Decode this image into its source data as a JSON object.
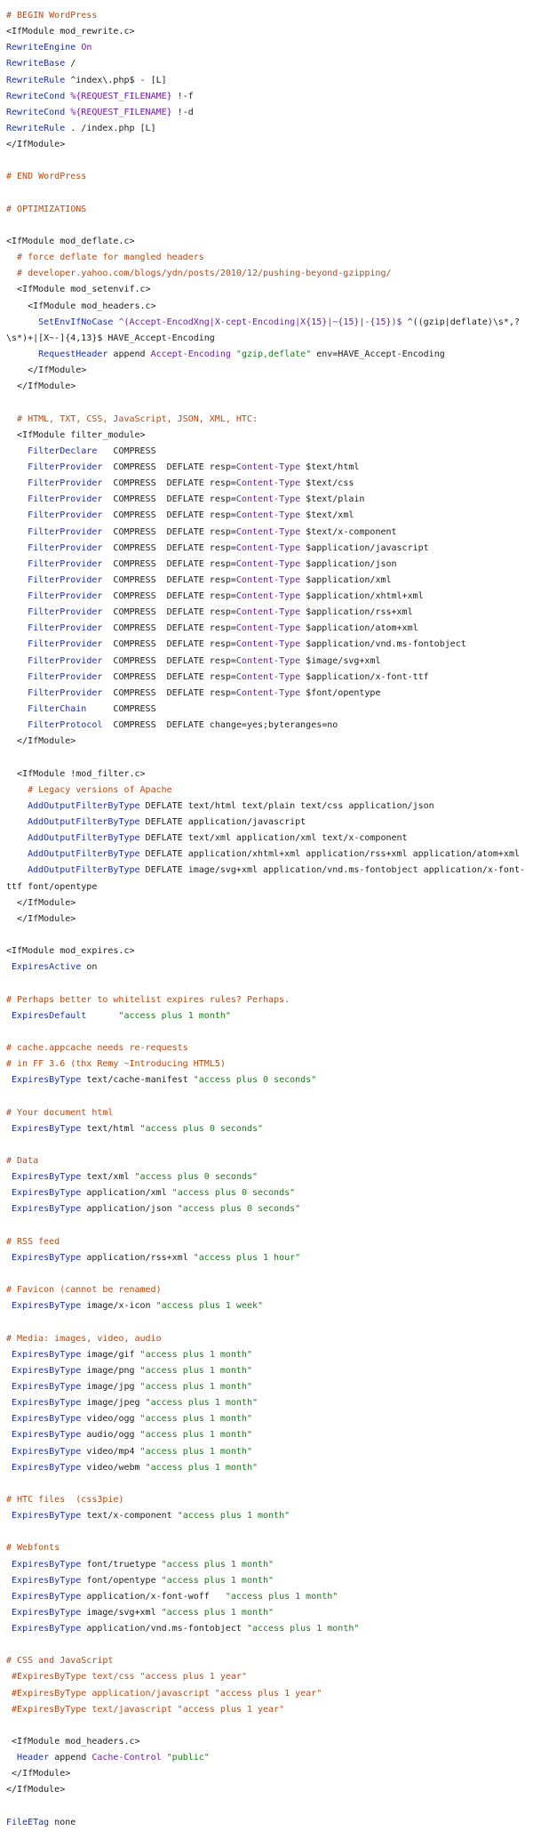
{
  "file": {
    "lines": [
      [
        [
          "c",
          "# BEGIN WordPress"
        ]
      ],
      [
        [
          "t",
          "<IfModule mod_rewrite.c>"
        ]
      ],
      [
        [
          "d",
          "RewriteEngine"
        ],
        [
          "p",
          " "
        ],
        [
          "v",
          "On"
        ]
      ],
      [
        [
          "d",
          "RewriteBase"
        ],
        [
          "p",
          " /"
        ]
      ],
      [
        [
          "d",
          "RewriteRule"
        ],
        [
          "p",
          " ^index\\.php$ - [L]"
        ]
      ],
      [
        [
          "d",
          "RewriteCond"
        ],
        [
          "p",
          " "
        ],
        [
          "v",
          "%{REQUEST_FILENAME}"
        ],
        [
          "p",
          " !-f"
        ]
      ],
      [
        [
          "d",
          "RewriteCond"
        ],
        [
          "p",
          " "
        ],
        [
          "v",
          "%{REQUEST_FILENAME}"
        ],
        [
          "p",
          " !-d"
        ]
      ],
      [
        [
          "d",
          "RewriteRule"
        ],
        [
          "p",
          " . /index.php [L]"
        ]
      ],
      [
        [
          "t",
          "</IfModule>"
        ]
      ],
      [],
      [
        [
          "c",
          "# END WordPress"
        ]
      ],
      [],
      [
        [
          "c",
          "# OPTIMIZATIONS"
        ]
      ],
      [],
      [
        [
          "t",
          "<IfModule mod_deflate.c>"
        ]
      ],
      [
        [
          "p",
          "  "
        ],
        [
          "c",
          "# force deflate for mangled headers"
        ]
      ],
      [
        [
          "p",
          "  "
        ],
        [
          "c",
          "# developer.yahoo.com/blogs/ydn/posts/2010/12/pushing-beyond-gzipping/"
        ]
      ],
      [
        [
          "p",
          "  "
        ],
        [
          "t",
          "<IfModule mod_setenvif.c>"
        ]
      ],
      [
        [
          "p",
          "    "
        ],
        [
          "t",
          "<IfModule mod_headers.c>"
        ]
      ],
      [
        [
          "p",
          "      "
        ],
        [
          "d",
          "SetEnvIfNoCase"
        ],
        [
          "p",
          " "
        ],
        [
          "v",
          "^(Accept-EncodXng|X-cept-Encoding|X{15}|~{15}|-{15})$"
        ],
        [
          "p",
          " ^((gzip|deflate)\\s*,?"
        ]
      ],
      [
        [
          "p",
          "\\s*)+|[X~-]{4,13}$ HAVE_Accept-Encoding"
        ]
      ],
      [
        [
          "p",
          "      "
        ],
        [
          "d",
          "RequestHeader"
        ],
        [
          "p",
          " append "
        ],
        [
          "v",
          "Accept-Encoding"
        ],
        [
          "p",
          " "
        ],
        [
          "s",
          "\"gzip,deflate\""
        ],
        [
          "p",
          " env=HAVE_Accept-Encoding"
        ]
      ],
      [
        [
          "p",
          "    "
        ],
        [
          "t",
          "</IfModule>"
        ]
      ],
      [
        [
          "p",
          "  "
        ],
        [
          "t",
          "</IfModule>"
        ]
      ],
      [],
      [
        [
          "p",
          "  "
        ],
        [
          "c",
          "# HTML, TXT, CSS, JavaScript, JSON, XML, HTC:"
        ]
      ],
      [
        [
          "p",
          "  "
        ],
        [
          "t",
          "<IfModule filter_module>"
        ]
      ],
      [
        [
          "p",
          "    "
        ],
        [
          "d",
          "FilterDeclare"
        ],
        [
          "p",
          "   COMPRESS"
        ]
      ],
      [
        [
          "p",
          "    "
        ],
        [
          "d",
          "FilterProvider"
        ],
        [
          "p",
          "  COMPRESS  DEFLATE resp="
        ],
        [
          "v",
          "Content-Type"
        ],
        [
          "p",
          " $text/html"
        ]
      ],
      [
        [
          "p",
          "    "
        ],
        [
          "d",
          "FilterProvider"
        ],
        [
          "p",
          "  COMPRESS  DEFLATE resp="
        ],
        [
          "v",
          "Content-Type"
        ],
        [
          "p",
          " $text/css"
        ]
      ],
      [
        [
          "p",
          "    "
        ],
        [
          "d",
          "FilterProvider"
        ],
        [
          "p",
          "  COMPRESS  DEFLATE resp="
        ],
        [
          "v",
          "Content-Type"
        ],
        [
          "p",
          " $text/plain"
        ]
      ],
      [
        [
          "p",
          "    "
        ],
        [
          "d",
          "FilterProvider"
        ],
        [
          "p",
          "  COMPRESS  DEFLATE resp="
        ],
        [
          "v",
          "Content-Type"
        ],
        [
          "p",
          " $text/xml"
        ]
      ],
      [
        [
          "p",
          "    "
        ],
        [
          "d",
          "FilterProvider"
        ],
        [
          "p",
          "  COMPRESS  DEFLATE resp="
        ],
        [
          "v",
          "Content-Type"
        ],
        [
          "p",
          " $text/x-component"
        ]
      ],
      [
        [
          "p",
          "    "
        ],
        [
          "d",
          "FilterProvider"
        ],
        [
          "p",
          "  COMPRESS  DEFLATE resp="
        ],
        [
          "v",
          "Content-Type"
        ],
        [
          "p",
          " $application/javascript"
        ]
      ],
      [
        [
          "p",
          "    "
        ],
        [
          "d",
          "FilterProvider"
        ],
        [
          "p",
          "  COMPRESS  DEFLATE resp="
        ],
        [
          "v",
          "Content-Type"
        ],
        [
          "p",
          " $application/json"
        ]
      ],
      [
        [
          "p",
          "    "
        ],
        [
          "d",
          "FilterProvider"
        ],
        [
          "p",
          "  COMPRESS  DEFLATE resp="
        ],
        [
          "v",
          "Content-Type"
        ],
        [
          "p",
          " $application/xml"
        ]
      ],
      [
        [
          "p",
          "    "
        ],
        [
          "d",
          "FilterProvider"
        ],
        [
          "p",
          "  COMPRESS  DEFLATE resp="
        ],
        [
          "v",
          "Content-Type"
        ],
        [
          "p",
          " $application/xhtml+xml"
        ]
      ],
      [
        [
          "p",
          "    "
        ],
        [
          "d",
          "FilterProvider"
        ],
        [
          "p",
          "  COMPRESS  DEFLATE resp="
        ],
        [
          "v",
          "Content-Type"
        ],
        [
          "p",
          " $application/rss+xml"
        ]
      ],
      [
        [
          "p",
          "    "
        ],
        [
          "d",
          "FilterProvider"
        ],
        [
          "p",
          "  COMPRESS  DEFLATE resp="
        ],
        [
          "v",
          "Content-Type"
        ],
        [
          "p",
          " $application/atom+xml"
        ]
      ],
      [
        [
          "p",
          "    "
        ],
        [
          "d",
          "FilterProvider"
        ],
        [
          "p",
          "  COMPRESS  DEFLATE resp="
        ],
        [
          "v",
          "Content-Type"
        ],
        [
          "p",
          " $application/vnd.ms-fontobject"
        ]
      ],
      [
        [
          "p",
          "    "
        ],
        [
          "d",
          "FilterProvider"
        ],
        [
          "p",
          "  COMPRESS  DEFLATE resp="
        ],
        [
          "v",
          "Content-Type"
        ],
        [
          "p",
          " $image/svg+xml"
        ]
      ],
      [
        [
          "p",
          "    "
        ],
        [
          "d",
          "FilterProvider"
        ],
        [
          "p",
          "  COMPRESS  DEFLATE resp="
        ],
        [
          "v",
          "Content-Type"
        ],
        [
          "p",
          " $application/x-font-ttf"
        ]
      ],
      [
        [
          "p",
          "    "
        ],
        [
          "d",
          "FilterProvider"
        ],
        [
          "p",
          "  COMPRESS  DEFLATE resp="
        ],
        [
          "v",
          "Content-Type"
        ],
        [
          "p",
          " $font/opentype"
        ]
      ],
      [
        [
          "p",
          "    "
        ],
        [
          "d",
          "FilterChain"
        ],
        [
          "p",
          "     COMPRESS"
        ]
      ],
      [
        [
          "p",
          "    "
        ],
        [
          "d",
          "FilterProtocol"
        ],
        [
          "p",
          "  COMPRESS  DEFLATE change=yes;byteranges=no"
        ]
      ],
      [
        [
          "p",
          "  "
        ],
        [
          "t",
          "</IfModule>"
        ]
      ],
      [],
      [
        [
          "p",
          "  "
        ],
        [
          "t",
          "<IfModule !mod_filter.c>"
        ]
      ],
      [
        [
          "p",
          "    "
        ],
        [
          "c",
          "# Legacy versions of Apache"
        ]
      ],
      [
        [
          "p",
          "    "
        ],
        [
          "d",
          "AddOutputFilterByType"
        ],
        [
          "p",
          " DEFLATE text/html text/plain text/css application/json"
        ]
      ],
      [
        [
          "p",
          "    "
        ],
        [
          "d",
          "AddOutputFilterByType"
        ],
        [
          "p",
          " DEFLATE application/javascript"
        ]
      ],
      [
        [
          "p",
          "    "
        ],
        [
          "d",
          "AddOutputFilterByType"
        ],
        [
          "p",
          " DEFLATE text/xml application/xml text/x-component"
        ]
      ],
      [
        [
          "p",
          "    "
        ],
        [
          "d",
          "AddOutputFilterByType"
        ],
        [
          "p",
          " DEFLATE application/xhtml+xml application/rss+xml application/atom+xml"
        ]
      ],
      [
        [
          "p",
          "    "
        ],
        [
          "d",
          "AddOutputFilterByType"
        ],
        [
          "p",
          " DEFLATE image/svg+xml application/vnd.ms-fontobject application/x-font-"
        ]
      ],
      [
        [
          "p",
          "ttf font/opentype"
        ]
      ],
      [
        [
          "p",
          "  "
        ],
        [
          "t",
          "</IfModule>"
        ]
      ],
      [
        [
          "p",
          "  "
        ],
        [
          "t",
          "</IfModule>"
        ]
      ],
      [],
      [
        [
          "t",
          "<IfModule mod_expires.c>"
        ]
      ],
      [
        [
          "p",
          " "
        ],
        [
          "d",
          "ExpiresActive"
        ],
        [
          "p",
          " on"
        ]
      ],
      [],
      [
        [
          "c",
          "# Perhaps better to whitelist expires rules? Perhaps."
        ]
      ],
      [
        [
          "p",
          " "
        ],
        [
          "d",
          "ExpiresDefault"
        ],
        [
          "p",
          "      "
        ],
        [
          "s",
          "\"access plus 1 month\""
        ]
      ],
      [],
      [
        [
          "c",
          "# cache.appcache needs re-requests"
        ]
      ],
      [
        [
          "c",
          "# in FF 3.6 (thx Remy ~Introducing HTML5)"
        ]
      ],
      [
        [
          "p",
          " "
        ],
        [
          "d",
          "ExpiresByType"
        ],
        [
          "p",
          " text/cache-manifest "
        ],
        [
          "s",
          "\"access plus 0 seconds\""
        ]
      ],
      [],
      [
        [
          "c",
          "# Your document html"
        ]
      ],
      [
        [
          "p",
          " "
        ],
        [
          "d",
          "ExpiresByType"
        ],
        [
          "p",
          " text/html "
        ],
        [
          "s",
          "\"access plus 0 seconds\""
        ]
      ],
      [],
      [
        [
          "c",
          "# Data"
        ]
      ],
      [
        [
          "p",
          " "
        ],
        [
          "d",
          "ExpiresByType"
        ],
        [
          "p",
          " text/xml "
        ],
        [
          "s",
          "\"access plus 0 seconds\""
        ]
      ],
      [
        [
          "p",
          " "
        ],
        [
          "d",
          "ExpiresByType"
        ],
        [
          "p",
          " application/xml "
        ],
        [
          "s",
          "\"access plus 0 seconds\""
        ]
      ],
      [
        [
          "p",
          " "
        ],
        [
          "d",
          "ExpiresByType"
        ],
        [
          "p",
          " application/json "
        ],
        [
          "s",
          "\"access plus 0 seconds\""
        ]
      ],
      [],
      [
        [
          "c",
          "# RSS feed"
        ]
      ],
      [
        [
          "p",
          " "
        ],
        [
          "d",
          "ExpiresByType"
        ],
        [
          "p",
          " application/rss+xml "
        ],
        [
          "s",
          "\"access plus 1 hour\""
        ]
      ],
      [],
      [
        [
          "c",
          "# Favicon (cannot be renamed)"
        ]
      ],
      [
        [
          "p",
          " "
        ],
        [
          "d",
          "ExpiresByType"
        ],
        [
          "p",
          " image/x-icon "
        ],
        [
          "s",
          "\"access plus 1 week\""
        ]
      ],
      [],
      [
        [
          "c",
          "# Media: images, video, audio"
        ]
      ],
      [
        [
          "p",
          " "
        ],
        [
          "d",
          "ExpiresByType"
        ],
        [
          "p",
          " image/gif "
        ],
        [
          "s",
          "\"access plus 1 month\""
        ]
      ],
      [
        [
          "p",
          " "
        ],
        [
          "d",
          "ExpiresByType"
        ],
        [
          "p",
          " image/png "
        ],
        [
          "s",
          "\"access plus 1 month\""
        ]
      ],
      [
        [
          "p",
          " "
        ],
        [
          "d",
          "ExpiresByType"
        ],
        [
          "p",
          " image/jpg "
        ],
        [
          "s",
          "\"access plus 1 month\""
        ]
      ],
      [
        [
          "p",
          " "
        ],
        [
          "d",
          "ExpiresByType"
        ],
        [
          "p",
          " image/jpeg "
        ],
        [
          "s",
          "\"access plus 1 month\""
        ]
      ],
      [
        [
          "p",
          " "
        ],
        [
          "d",
          "ExpiresByType"
        ],
        [
          "p",
          " video/ogg "
        ],
        [
          "s",
          "\"access plus 1 month\""
        ]
      ],
      [
        [
          "p",
          " "
        ],
        [
          "d",
          "ExpiresByType"
        ],
        [
          "p",
          " audio/ogg "
        ],
        [
          "s",
          "\"access plus 1 month\""
        ]
      ],
      [
        [
          "p",
          " "
        ],
        [
          "d",
          "ExpiresByType"
        ],
        [
          "p",
          " video/mp4 "
        ],
        [
          "s",
          "\"access plus 1 month\""
        ]
      ],
      [
        [
          "p",
          " "
        ],
        [
          "d",
          "ExpiresByType"
        ],
        [
          "p",
          " video/webm "
        ],
        [
          "s",
          "\"access plus 1 month\""
        ]
      ],
      [],
      [
        [
          "c",
          "# HTC files  (css3pie)"
        ]
      ],
      [
        [
          "p",
          " "
        ],
        [
          "d",
          "ExpiresByType"
        ],
        [
          "p",
          " text/x-component "
        ],
        [
          "s",
          "\"access plus 1 month\""
        ]
      ],
      [],
      [
        [
          "c",
          "# Webfonts"
        ]
      ],
      [
        [
          "p",
          " "
        ],
        [
          "d",
          "ExpiresByType"
        ],
        [
          "p",
          " font/truetype "
        ],
        [
          "s",
          "\"access plus 1 month\""
        ]
      ],
      [
        [
          "p",
          " "
        ],
        [
          "d",
          "ExpiresByType"
        ],
        [
          "p",
          " font/opentype "
        ],
        [
          "s",
          "\"access plus 1 month\""
        ]
      ],
      [
        [
          "p",
          " "
        ],
        [
          "d",
          "ExpiresByType"
        ],
        [
          "p",
          " application/x-font-woff   "
        ],
        [
          "s",
          "\"access plus 1 month\""
        ]
      ],
      [
        [
          "p",
          " "
        ],
        [
          "d",
          "ExpiresByType"
        ],
        [
          "p",
          " image/svg+xml "
        ],
        [
          "s",
          "\"access plus 1 month\""
        ]
      ],
      [
        [
          "p",
          " "
        ],
        [
          "d",
          "ExpiresByType"
        ],
        [
          "p",
          " application/vnd.ms-fontobject "
        ],
        [
          "s",
          "\"access plus 1 month\""
        ]
      ],
      [],
      [
        [
          "c",
          "# CSS and JavaScript"
        ]
      ],
      [
        [
          "p",
          " "
        ],
        [
          "c",
          "#ExpiresByType text/css \"access plus 1 year\""
        ]
      ],
      [
        [
          "p",
          " "
        ],
        [
          "c",
          "#ExpiresByType application/javascript \"access plus 1 year\""
        ]
      ],
      [
        [
          "p",
          " "
        ],
        [
          "c",
          "#ExpiresByType text/javascript \"access plus 1 year\""
        ]
      ],
      [],
      [
        [
          "p",
          " "
        ],
        [
          "t",
          "<IfModule mod_headers.c>"
        ]
      ],
      [
        [
          "p",
          "  "
        ],
        [
          "d",
          "Header"
        ],
        [
          "p",
          " append "
        ],
        [
          "v",
          "Cache-Control"
        ],
        [
          "p",
          " "
        ],
        [
          "s",
          "\"public\""
        ]
      ],
      [
        [
          "p",
          " "
        ],
        [
          "t",
          "</IfModule>"
        ]
      ],
      [
        [
          "t",
          "</IfModule>"
        ]
      ],
      [],
      [
        [
          "d",
          "FileETag"
        ],
        [
          "p",
          " none"
        ]
      ]
    ]
  }
}
